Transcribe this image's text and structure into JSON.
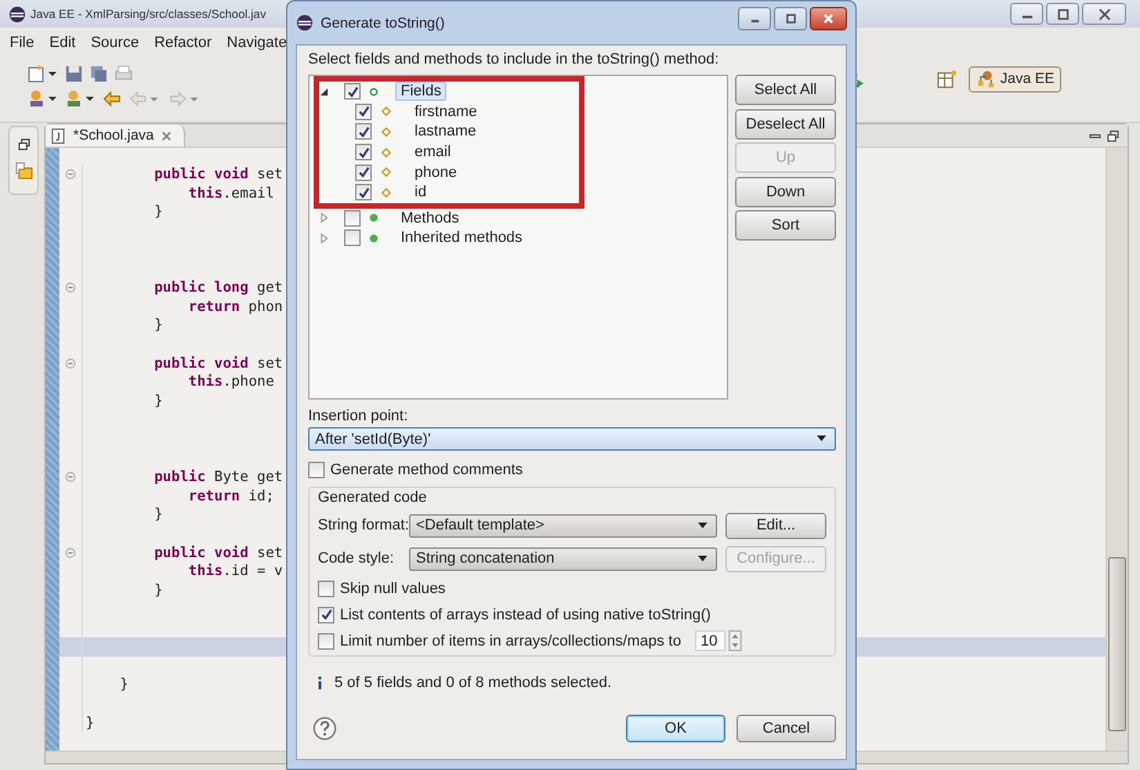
{
  "ide": {
    "title": "Java EE - XmlParsing/src/classes/School.jav",
    "menu": [
      "File",
      "Edit",
      "Source",
      "Refactor",
      "Navigate"
    ],
    "perspective": "Java EE",
    "editor_tab": {
      "label": "*School.java"
    },
    "code_lines": [
      {
        "text": "        **public** **void** set",
        "fold": true,
        "current": false
      },
      {
        "text": "            **this**.email",
        "fold": false,
        "current": false
      },
      {
        "text": "        }",
        "fold": false,
        "current": false
      },
      {
        "current": false
      },
      {
        "current": false
      },
      {
        "current": false
      },
      {
        "text": "        **public** **long** get",
        "fold": true,
        "current": false
      },
      {
        "text": "            **return** phon",
        "fold": false,
        "current": false
      },
      {
        "text": "        }",
        "fold": false,
        "current": false
      },
      {
        "current": false
      },
      {
        "text": "        **public** **void** set",
        "fold": true,
        "current": false
      },
      {
        "text": "            **this**.phone",
        "fold": false,
        "current": false
      },
      {
        "text": "        }",
        "fold": false,
        "current": false
      },
      {
        "current": false
      },
      {
        "current": false
      },
      {
        "current": false
      },
      {
        "text": "        **public** Byte get",
        "fold": true,
        "current": false
      },
      {
        "text": "            **return** id;",
        "fold": false,
        "current": false
      },
      {
        "text": "        }",
        "fold": false,
        "current": false
      },
      {
        "current": false
      },
      {
        "text": "        **public** **void** set",
        "fold": true,
        "current": false
      },
      {
        "text": "            **this**.id = v",
        "fold": false,
        "current": false
      },
      {
        "text": "        }",
        "fold": false,
        "current": false
      },
      {
        "current": false
      },
      {
        "current": false
      },
      {
        "current": true
      },
      {
        "current": false
      },
      {
        "text": "    }",
        "fold": false,
        "current": false
      },
      {
        "current": false
      },
      {
        "text": "}",
        "fold": false,
        "current": false
      }
    ]
  },
  "dialog": {
    "title": "Generate toString()",
    "prompt": "Select fields and methods to include in the toString() method:",
    "tree": [
      {
        "label": "Fields",
        "kind": "field-group",
        "checked": true,
        "expanded": true,
        "selected": true,
        "annotated": true,
        "children": [
          {
            "label": "firstname",
            "kind": "field",
            "checked": true,
            "selected": false
          },
          {
            "label": "lastname",
            "kind": "field",
            "checked": true,
            "selected": false
          },
          {
            "label": "email",
            "kind": "field",
            "checked": true,
            "selected": false
          },
          {
            "label": "phone",
            "kind": "field",
            "checked": true,
            "selected": false
          },
          {
            "label": "id",
            "kind": "field",
            "checked": true,
            "selected": false
          }
        ]
      },
      {
        "label": "Methods",
        "kind": "method-group",
        "checked": false,
        "expanded": false,
        "selected": false,
        "annotated": false
      },
      {
        "label": "Inherited methods",
        "kind": "method-group",
        "checked": false,
        "expanded": false,
        "selected": false,
        "annotated": false
      }
    ],
    "side_buttons": [
      {
        "label": "Select All",
        "disabled": false
      },
      {
        "label": "Deselect All",
        "disabled": false
      },
      {
        "label": "Up",
        "disabled": true
      },
      {
        "label": "Down",
        "disabled": false
      },
      {
        "label": "Sort",
        "disabled": false
      }
    ],
    "insertion_point": {
      "label": "Insertion point:",
      "value": "After 'setId(Byte)'"
    },
    "generate_comments": {
      "label": "Generate method comments",
      "checked": false
    },
    "generated_code": {
      "title": "Generated code",
      "rows": [
        {
          "label": "String format:",
          "value": "<Default template>",
          "button": "Edit...",
          "button_disabled": false
        },
        {
          "label": "Code style:",
          "value": "String concatenation",
          "button": "Configure...",
          "button_disabled": true
        }
      ],
      "options": [
        {
          "label": "Skip null values",
          "checked": false
        },
        {
          "label": "List contents of arrays instead of using native toString()",
          "checked": true
        }
      ],
      "limit": {
        "label": "Limit number of items in arrays/collections/maps to",
        "checked": false,
        "value": "10"
      }
    },
    "status": "5 of 5 fields and 0 of 8 methods selected.",
    "buttons": [
      {
        "label": "OK",
        "default": true
      },
      {
        "label": "Cancel",
        "default": false
      }
    ]
  }
}
